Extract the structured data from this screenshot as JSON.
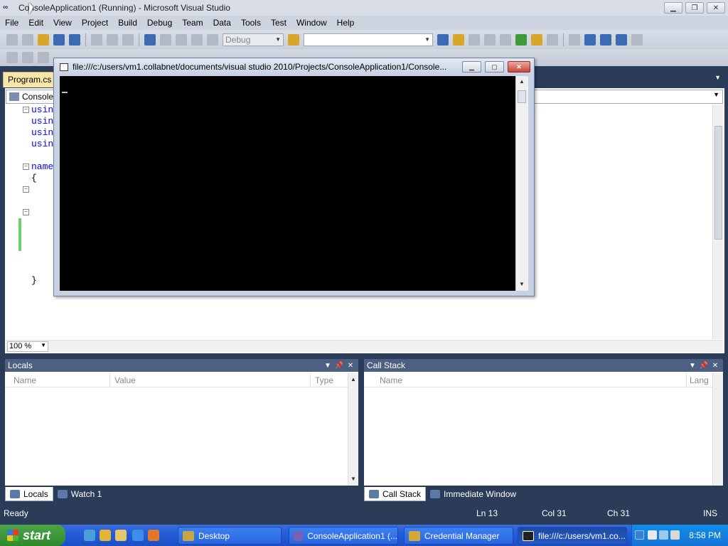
{
  "window": {
    "title": "ConsoleApplication1 (Running) - Microsoft Visual Studio",
    "app_icon": "visual-studio-icon"
  },
  "menu": [
    "File",
    "Edit",
    "View",
    "Project",
    "Build",
    "Debug",
    "Team",
    "Data",
    "Tools",
    "Test",
    "Window",
    "Help"
  ],
  "toolbar": {
    "solution_config": "Debug",
    "find_combo_value": ""
  },
  "document": {
    "tab_label": "Program.cs",
    "nav_combo_value": "ConsoleA",
    "code_lines": [
      {
        "text": "using",
        "kind": "keyword"
      },
      {
        "text": "using",
        "kind": "keyword"
      },
      {
        "text": "using",
        "kind": "keyword"
      },
      {
        "text": "using",
        "kind": "keyword"
      },
      {
        "text": "names",
        "kind": "keyword"
      },
      {
        "text": "{",
        "kind": "plain"
      },
      {
        "text": "}",
        "kind": "plain"
      }
    ],
    "zoom": "100 %"
  },
  "console_window": {
    "title": "file:///c:/users/vm1.collabnet/documents/visual studio 2010/Projects/ConsoleApplication1/Console..."
  },
  "locals": {
    "title": "Locals",
    "columns": [
      "Name",
      "Value",
      "Type"
    ]
  },
  "callstack": {
    "title": "Call Stack",
    "columns": [
      "Name",
      "Lang"
    ]
  },
  "bottom_tabs_left": [
    "Locals",
    "Watch 1"
  ],
  "bottom_tabs_right": [
    "Call Stack",
    "Immediate Window"
  ],
  "status": {
    "state": "Ready",
    "line": "Ln 13",
    "col": "Col 31",
    "ch": "Ch 31",
    "mode": "INS"
  },
  "taskbar": {
    "start_label": "start",
    "buttons": [
      "Desktop",
      "ConsoleApplication1 (...",
      "Credential Manager",
      "file:///c:/users/vm1.co..."
    ],
    "clock": "8:58 PM"
  }
}
